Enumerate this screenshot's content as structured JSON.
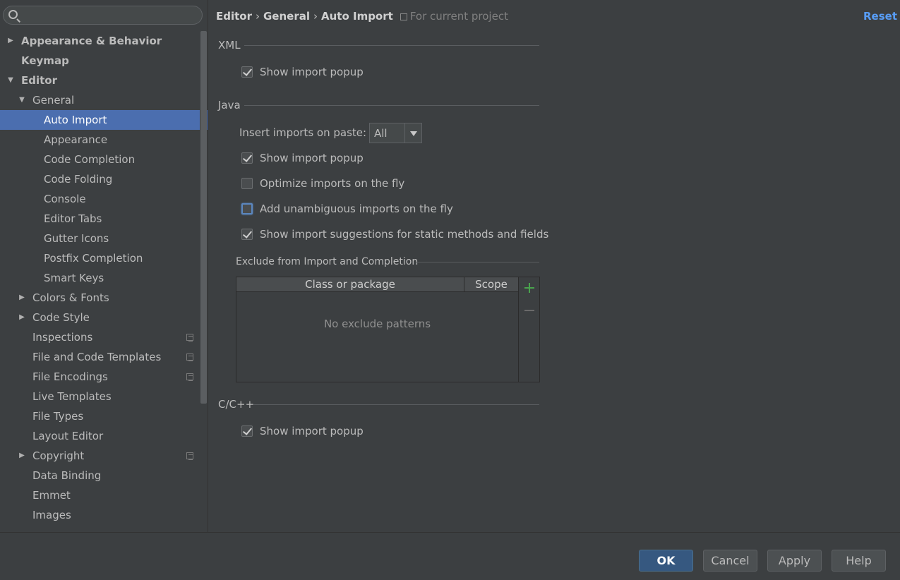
{
  "sidebar": {
    "search_placeholder": "",
    "items": [
      {
        "label": "Appearance & Behavior"
      },
      {
        "label": "Keymap"
      },
      {
        "label": "Editor"
      },
      {
        "label": "General"
      },
      {
        "label": "Auto Import"
      },
      {
        "label": "Appearance"
      },
      {
        "label": "Code Completion"
      },
      {
        "label": "Code Folding"
      },
      {
        "label": "Console"
      },
      {
        "label": "Editor Tabs"
      },
      {
        "label": "Gutter Icons"
      },
      {
        "label": "Postfix Completion"
      },
      {
        "label": "Smart Keys"
      },
      {
        "label": "Colors & Fonts"
      },
      {
        "label": "Code Style"
      },
      {
        "label": "Inspections"
      },
      {
        "label": "File and Code Templates"
      },
      {
        "label": "File Encodings"
      },
      {
        "label": "Live Templates"
      },
      {
        "label": "File Types"
      },
      {
        "label": "Layout Editor"
      },
      {
        "label": "Copyright"
      },
      {
        "label": "Data Binding"
      },
      {
        "label": "Emmet"
      },
      {
        "label": "Images"
      }
    ]
  },
  "header": {
    "crumbs": [
      "Editor",
      "General",
      "Auto Import"
    ],
    "scope_hint": "For current project",
    "reset_label": "Reset"
  },
  "xml": {
    "title": "XML",
    "show_popup_label": "Show import popup"
  },
  "java": {
    "title": "Java",
    "insert_on_paste_label": "Insert imports on paste:",
    "insert_on_paste_value": "All",
    "show_popup_label": "Show import popup",
    "optimize_label": "Optimize imports on the fly",
    "add_unambiguous_label": "Add unambiguous imports on the fly",
    "static_suggestions_label": "Show import suggestions for static methods and fields"
  },
  "exclude": {
    "title": "Exclude from Import and Completion",
    "col_class": "Class or package",
    "col_scope": "Scope",
    "empty_text": "No exclude patterns"
  },
  "cpp": {
    "title": "C/C++",
    "show_popup_label": "Show import popup"
  },
  "footer": {
    "ok": "OK",
    "cancel": "Cancel",
    "apply": "Apply",
    "help": "Help"
  },
  "colors": {
    "selection": "#4b6eaf",
    "link": "#589df6",
    "background": "#3c3f41"
  }
}
